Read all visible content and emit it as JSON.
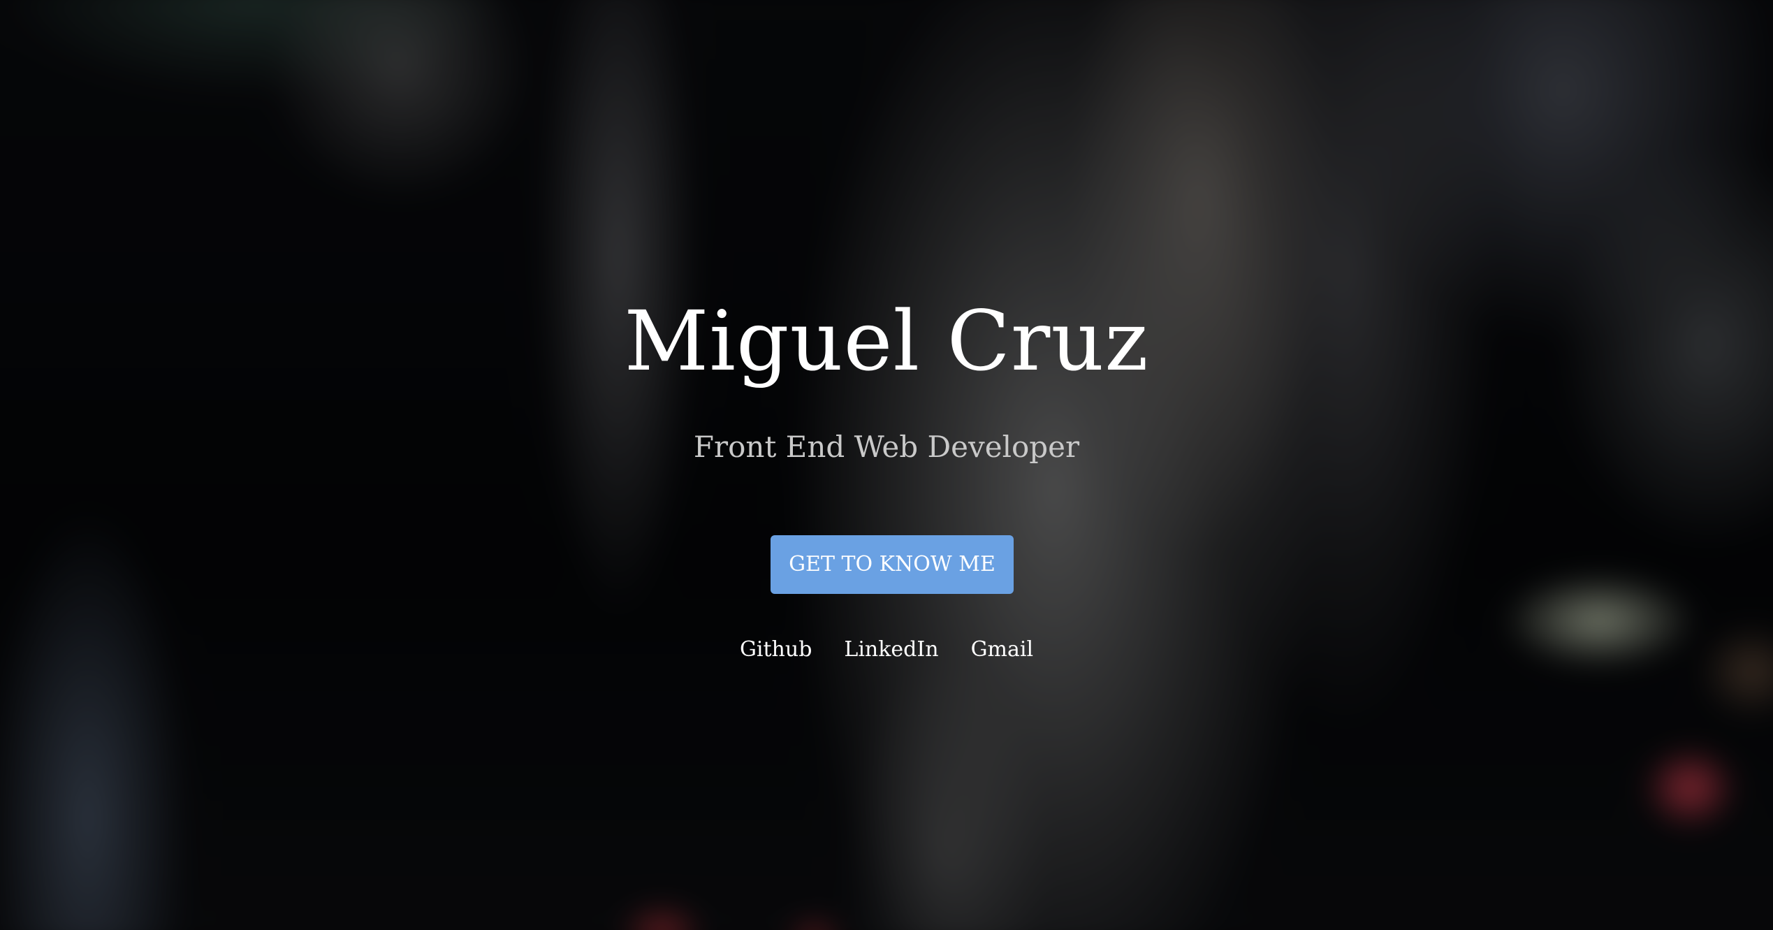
{
  "hero": {
    "name": "Miguel Cruz",
    "subtitle": "Front End Web Developer",
    "cta_label": "GET TO KNOW ME",
    "accent_color": "#6aa1e3"
  },
  "social_links": [
    {
      "label": "Github"
    },
    {
      "label": "LinkedIn"
    },
    {
      "label": "Gmail"
    }
  ]
}
